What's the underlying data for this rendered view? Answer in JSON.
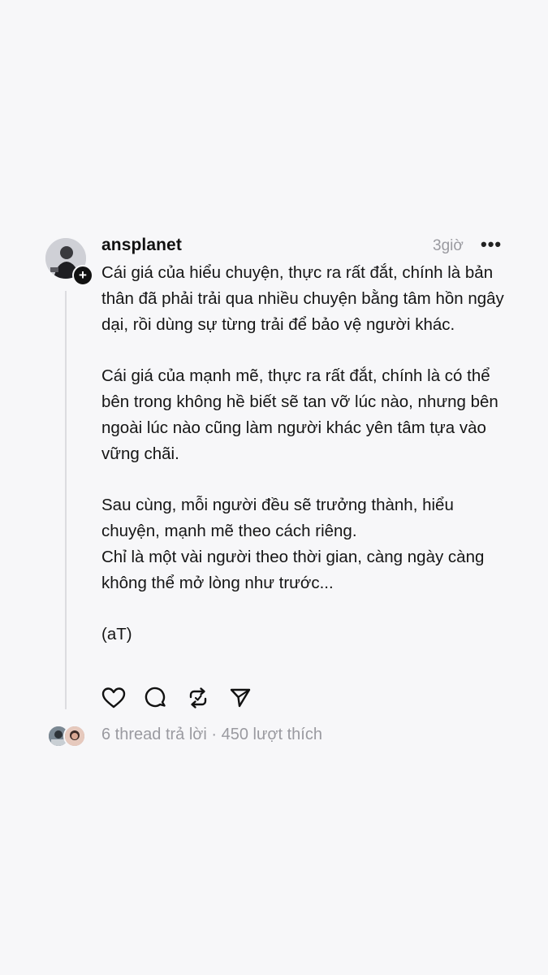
{
  "post": {
    "username": "ansplanet",
    "time": "3giờ",
    "more": "•••",
    "follow_badge": "+",
    "paragraphs": [
      "Cái giá của hiểu chuyện, thực ra rất đắt, chính là bản thân đã phải trải qua nhiều chuyện bằng tâm hồn ngây dại, rồi dùng sự từng trải để bảo vệ người khác.",
      "Cái giá của mạnh mẽ, thực ra rất đắt, chính là có thể bên trong không hề biết sẽ tan vỡ lúc nào, nhưng bên ngoài lúc nào cũng làm người khác yên tâm tựa vào vững chãi.",
      "Sau cùng, mỗi người đều sẽ trưởng thành, hiểu chuyện, mạnh mẽ theo cách riêng.",
      "Chỉ là một vài người theo thời gian, càng ngày càng không thể mở lòng như trước...",
      "(aT)"
    ],
    "actions": [
      "heart-icon",
      "comment-icon",
      "repost-icon",
      "share-icon"
    ],
    "stats": {
      "replies": "6 thread trả lời",
      "separator": " · ",
      "likes": "450 lượt thích"
    }
  }
}
